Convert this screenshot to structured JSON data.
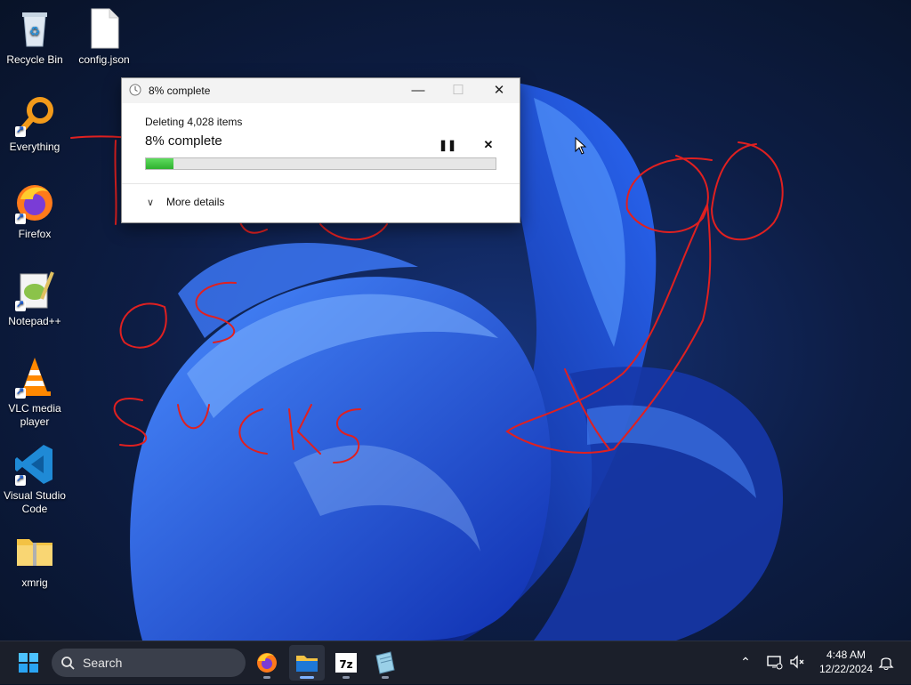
{
  "desktop": {
    "icons": [
      {
        "label": "Recycle Bin"
      },
      {
        "label": "config.json"
      },
      {
        "label": "Everything"
      },
      {
        "label": "Firefox"
      },
      {
        "label": "Notepad++"
      },
      {
        "label": "VLC media player"
      },
      {
        "label": "Visual Studio Code"
      },
      {
        "label": "xmrig"
      }
    ],
    "annotation_color": "#e02020"
  },
  "dialog": {
    "window_title": "8% complete",
    "subtitle": "Deleting 4,028 items",
    "status": "8% complete",
    "progress_percent": 8,
    "more_details_label": "More details",
    "icons": {
      "minimize": "minimize-icon",
      "maximize": "maximize-icon",
      "close": "close-icon",
      "pause": "pause-icon",
      "stop": "stop-icon"
    }
  },
  "taskbar": {
    "search_placeholder": "Search",
    "apps": [
      "Firefox",
      "File Explorer",
      "7-Zip",
      "Notepad"
    ],
    "active_app": "File Explorer",
    "clock": {
      "time": "4:48 AM",
      "date": "12/22/2024"
    },
    "accent": "#7fb2ff"
  }
}
